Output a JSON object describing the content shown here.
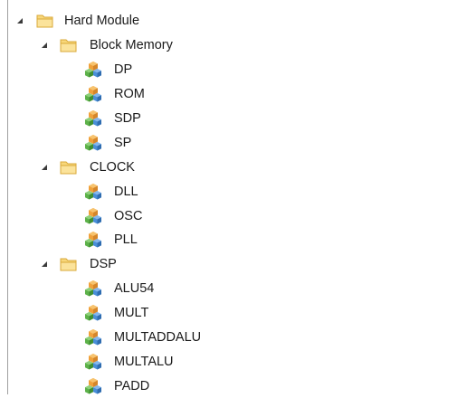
{
  "tree": {
    "root": {
      "label": "Hard Module",
      "expanded": true,
      "icon": "folder-icon",
      "groups": [
        {
          "label": "Block Memory",
          "expanded": true,
          "icon": "folder-icon",
          "items": [
            "DP",
            "ROM",
            "SDP",
            "SP"
          ]
        },
        {
          "label": "CLOCK",
          "expanded": true,
          "icon": "folder-icon",
          "items": [
            "DLL",
            "OSC",
            "PLL"
          ]
        },
        {
          "label": "DSP",
          "expanded": true,
          "icon": "folder-icon",
          "items": [
            "ALU54",
            "MULT",
            "MULTADDALU",
            "MULTALU",
            "PADD"
          ]
        }
      ]
    },
    "item_icon": "module-cubes-icon"
  },
  "colors": {
    "folder_fill": "#F8D77A",
    "folder_edge": "#D9A93A",
    "expander": "#3a3a3a",
    "cube_orange": "#F0A13A",
    "cube_green": "#5DB24A",
    "cube_blue": "#4A8FD8"
  }
}
